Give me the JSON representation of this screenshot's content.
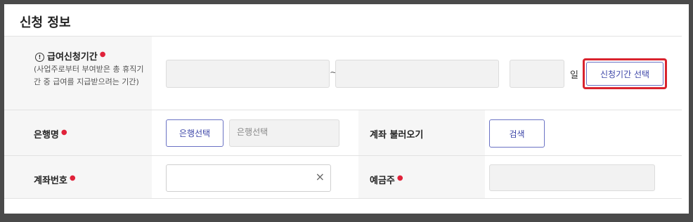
{
  "section": {
    "title": "신청 정보"
  },
  "period": {
    "icon": "info-circle-icon",
    "label": "급여신청기간",
    "help": "(사업주로부터 부여받은 총 휴직기간 중 급여를 지급받으려는 기간)",
    "range_sep": "~",
    "day_suffix": "일",
    "select_button": "신청기간 선택"
  },
  "bank": {
    "label": "은행명",
    "select_button": "은행선택",
    "field_placeholder": "은행선택"
  },
  "account_fetch": {
    "label": "계좌 불러오기",
    "search_button": "검색"
  },
  "account_number": {
    "label": "계좌번호",
    "clear": "×"
  },
  "depositor": {
    "label": "예금주"
  },
  "colors": {
    "required": "#e0223a",
    "accent": "#3d46a8",
    "highlight": "#d9232e"
  }
}
